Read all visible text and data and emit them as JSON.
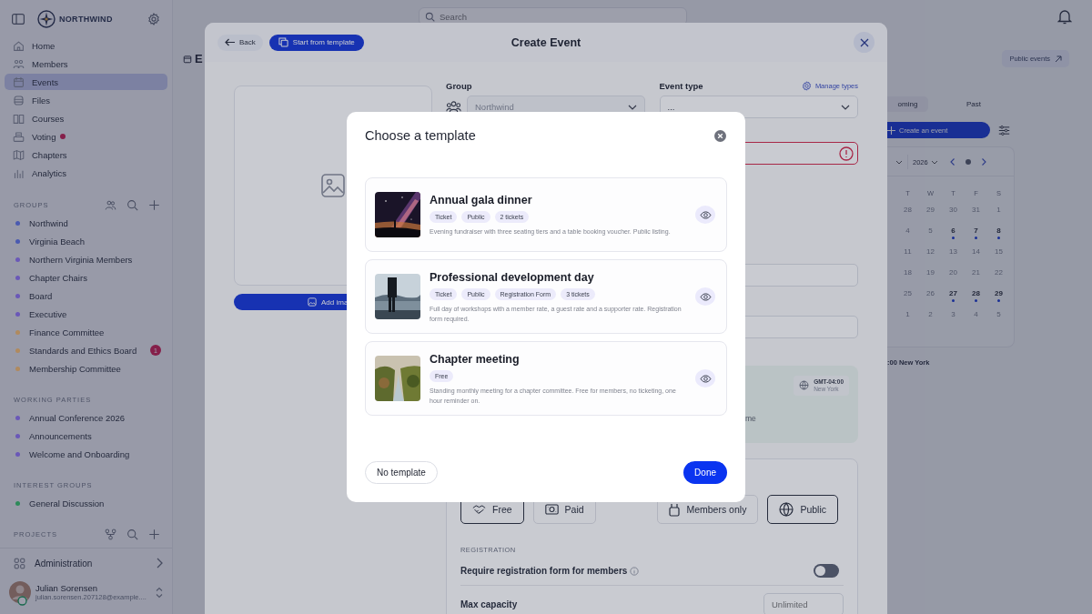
{
  "sidebar": {
    "brand": "NORTHWIND",
    "nav": [
      {
        "label": "Home",
        "selected": false,
        "alert": false
      },
      {
        "label": "Members",
        "selected": false,
        "alert": false
      },
      {
        "label": "Events",
        "selected": true,
        "alert": false
      },
      {
        "label": "Files",
        "selected": false,
        "alert": false
      },
      {
        "label": "Courses",
        "selected": false,
        "alert": false
      },
      {
        "label": "Voting",
        "selected": false,
        "alert": true
      },
      {
        "label": "Chapters",
        "selected": false,
        "alert": false
      },
      {
        "label": "Analytics",
        "selected": false,
        "alert": false
      }
    ],
    "sections": [
      {
        "title": "GROUPS",
        "kind": "groups",
        "items": [
          {
            "label": "Northwind",
            "color": "#4a5ab0"
          },
          {
            "label": "Virginia Beach",
            "color": "#4a5ab0"
          },
          {
            "label": "Northern Virginia Members",
            "color": "#6a58b8"
          },
          {
            "label": "Chapter Chairs",
            "color": "#6a58b8"
          },
          {
            "label": "Board",
            "color": "#6a58b8"
          },
          {
            "label": "Executive",
            "color": "#6a58b8"
          },
          {
            "label": "Finance Committee",
            "color": "#b08a5e"
          },
          {
            "label": "Standards and Ethics Board",
            "color": "#b08a5e",
            "badge": "1"
          },
          {
            "label": "Membership Committee",
            "color": "#b08a5e"
          }
        ]
      },
      {
        "title": "WORKING PARTIES",
        "kind": "plain",
        "items": [
          {
            "label": "Annual Conference 2026",
            "color": "#6a58b8"
          },
          {
            "label": "Announcements",
            "color": "#6a58b8"
          },
          {
            "label": "Welcome and Onboarding",
            "color": "#6a58b8"
          }
        ]
      },
      {
        "title": "INTEREST GROUPS",
        "kind": "plain",
        "items": [
          {
            "label": "General Discussion",
            "color": "#2e8a5a"
          }
        ]
      },
      {
        "title": "PROJECTS",
        "kind": "projects"
      }
    ],
    "admin": "Administration",
    "user": {
      "name": "Julian Sorensen",
      "email": "julian.sorensen.207128@example...."
    }
  },
  "topbar": {
    "search_placeholder": "Search"
  },
  "page": {
    "title": "E",
    "public_events": "Public events",
    "tabs": [
      {
        "label": "oming",
        "selected": true
      },
      {
        "label": "Past",
        "selected": false
      }
    ],
    "create_button": "Create an event",
    "calendar": {
      "year": "2026",
      "weekdays": [
        "T",
        "W",
        "T",
        "F",
        "S"
      ],
      "weeks": [
        [
          {
            "day": "28",
            "marked": false
          },
          {
            "day": "29",
            "marked": false
          },
          {
            "day": "30",
            "marked": false
          },
          {
            "day": "31",
            "marked": false
          },
          {
            "day": "1",
            "marked": false
          }
        ],
        [
          {
            "day": "4",
            "marked": false
          },
          {
            "day": "5",
            "marked": false
          },
          {
            "day": "6",
            "marked": true
          },
          {
            "day": "7",
            "marked": true
          },
          {
            "day": "8",
            "marked": true
          }
        ],
        [
          {
            "day": "11",
            "marked": false
          },
          {
            "day": "12",
            "marked": false
          },
          {
            "day": "13",
            "marked": false
          },
          {
            "day": "14",
            "marked": false
          },
          {
            "day": "15",
            "marked": false
          }
        ],
        [
          {
            "day": "18",
            "marked": false
          },
          {
            "day": "19",
            "marked": false
          },
          {
            "day": "20",
            "marked": false
          },
          {
            "day": "21",
            "marked": false
          },
          {
            "day": "22",
            "marked": false
          }
        ],
        [
          {
            "day": "25",
            "marked": false
          },
          {
            "day": "26",
            "marked": false
          },
          {
            "day": "27",
            "marked": true
          },
          {
            "day": "28",
            "marked": true
          },
          {
            "day": "29",
            "marked": true
          }
        ],
        [
          {
            "day": "1",
            "marked": false
          },
          {
            "day": "2",
            "marked": false
          },
          {
            "day": "3",
            "marked": false
          },
          {
            "day": "4",
            "marked": false
          },
          {
            "day": "5",
            "marked": false
          }
        ]
      ]
    },
    "timezone_note": ":00 New York"
  },
  "create_event": {
    "title": "Create Event",
    "back": "Back",
    "template_button": "Start from template",
    "add_image": "Add ima",
    "group": {
      "label": "Group",
      "value": "Northwind"
    },
    "event_type": {
      "label": "Event type",
      "manage": "Manage types",
      "value": "..."
    },
    "title_field": {
      "invalid": true
    },
    "timezone": {
      "offset": "GMT-04:00",
      "city": "New York"
    },
    "partial_text": "me",
    "pricing": [
      {
        "label": "Free",
        "selected": true
      },
      {
        "label": "Paid",
        "selected": false
      }
    ],
    "visibility": [
      {
        "label": "Members only",
        "selected": false
      },
      {
        "label": "Public",
        "selected": true
      }
    ],
    "registration": {
      "heading": "REGISTRATION",
      "require_label": "Require registration form for members",
      "require_on": false,
      "capacity_label": "Max capacity",
      "capacity_placeholder": "Unlimited"
    }
  },
  "template_dialog": {
    "title": "Choose a template",
    "templates": [
      {
        "name": "Annual gala dinner",
        "tags": [
          "Ticket",
          "Public",
          "2 tickets"
        ],
        "description": "Evening fundraiser with three seating tiers and a table booking voucher. Public listing."
      },
      {
        "name": "Professional development day",
        "tags": [
          "Ticket",
          "Public",
          "Registration Form",
          "3 tickets"
        ],
        "description": "Full day of workshops with a member rate, a guest rate and a supporter rate. Registration form required."
      },
      {
        "name": "Chapter meeting",
        "tags": [
          "Free"
        ],
        "description": "Standing monthly meeting for a chapter committee. Free for members, no ticketing, one hour reminder on."
      }
    ],
    "no_template": "No template",
    "done": "Done"
  }
}
